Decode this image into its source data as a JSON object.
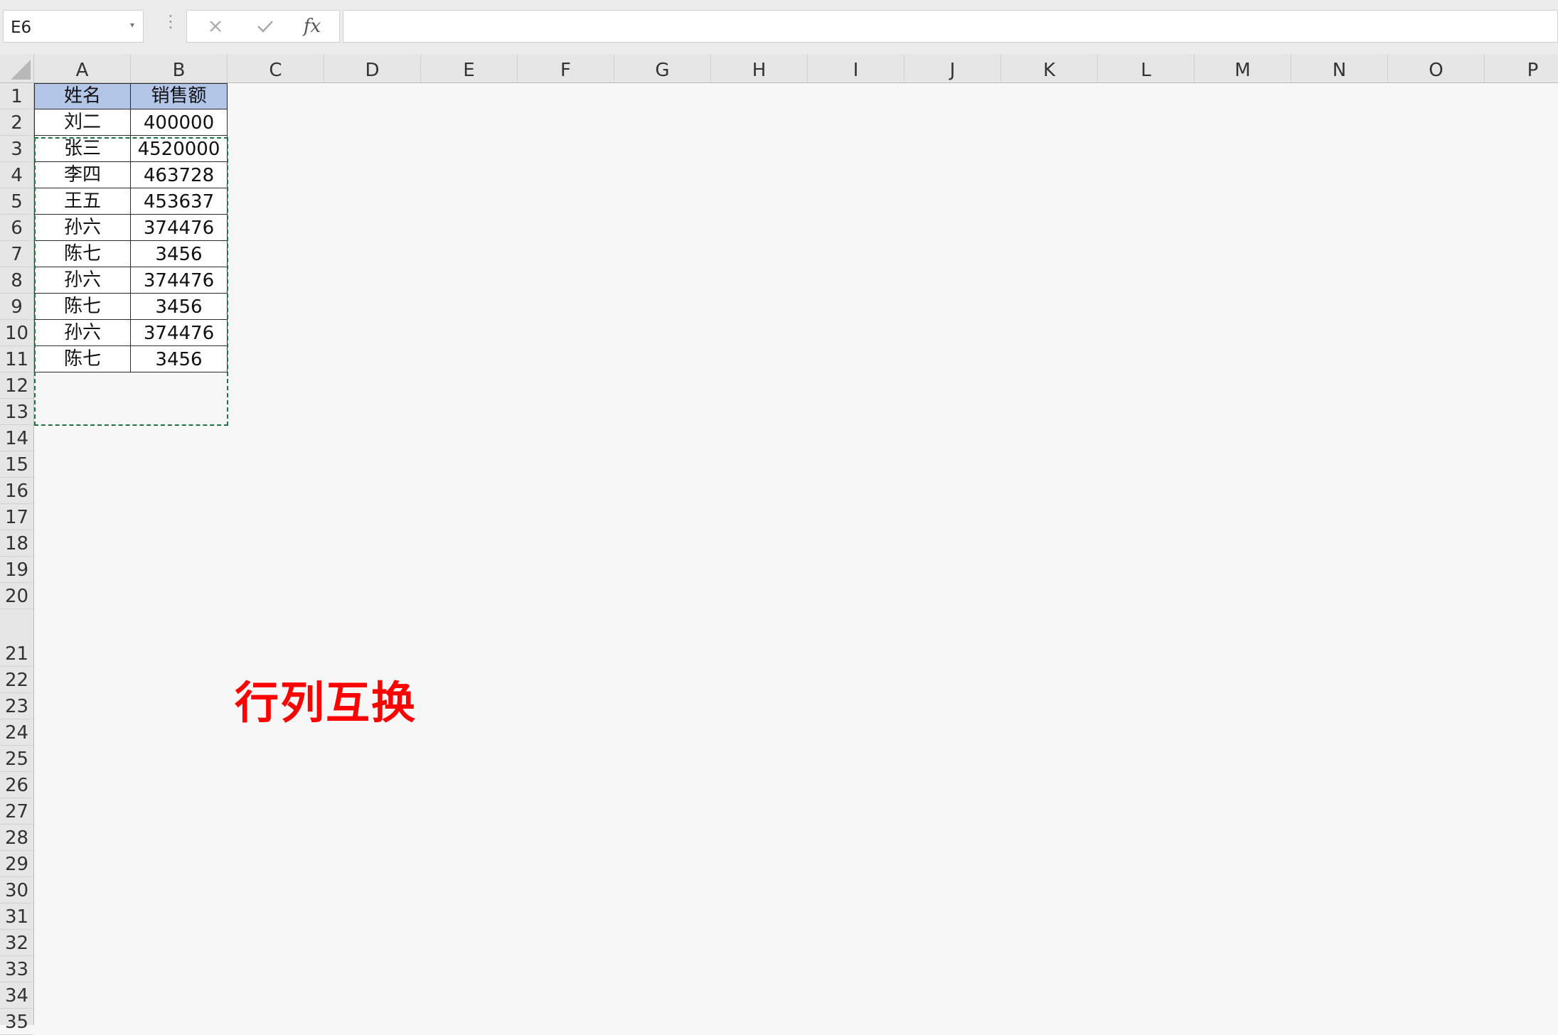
{
  "formula_bar": {
    "name_box": "E6",
    "name_box_caret": "▾",
    "grip": "⋮",
    "cancel_symbol": "✕",
    "enter_symbol": "✓",
    "function_symbol": "fx",
    "formula_value": ""
  },
  "columns": [
    "A",
    "B",
    "C",
    "D",
    "E",
    "F",
    "G",
    "H",
    "I",
    "J",
    "K",
    "L",
    "M",
    "N",
    "O",
    "P"
  ],
  "rows": [
    "1",
    "2",
    "3",
    "4",
    "5",
    "6",
    "7",
    "8",
    "9",
    "10",
    "11",
    "12",
    "13",
    "14",
    "15",
    "16",
    "17",
    "18",
    "19",
    "20",
    "21",
    "22",
    "23",
    "24",
    "25",
    "26",
    "27",
    "28",
    "29",
    "30",
    "31",
    "32",
    "33",
    "34",
    "35"
  ],
  "table": {
    "header": [
      "姓名",
      "销售额"
    ],
    "rows": [
      [
        "刘二",
        "400000"
      ],
      [
        "张三",
        "4520000"
      ],
      [
        "李四",
        "463728"
      ],
      [
        "王五",
        "453637"
      ],
      [
        "孙六",
        "374476"
      ],
      [
        "陈七",
        "3456"
      ],
      [
        "孙六",
        "374476"
      ],
      [
        "陈七",
        "3456"
      ],
      [
        "孙六",
        "374476"
      ],
      [
        "陈七",
        "3456"
      ]
    ]
  },
  "overlay_title": "行列互换",
  "colors": {
    "header_fill": "#b4c6e7",
    "marquee": "#217346",
    "title": "#ff0000"
  },
  "icons": {
    "cancel": "close-icon",
    "enter": "check-icon",
    "function": "fx-icon"
  }
}
